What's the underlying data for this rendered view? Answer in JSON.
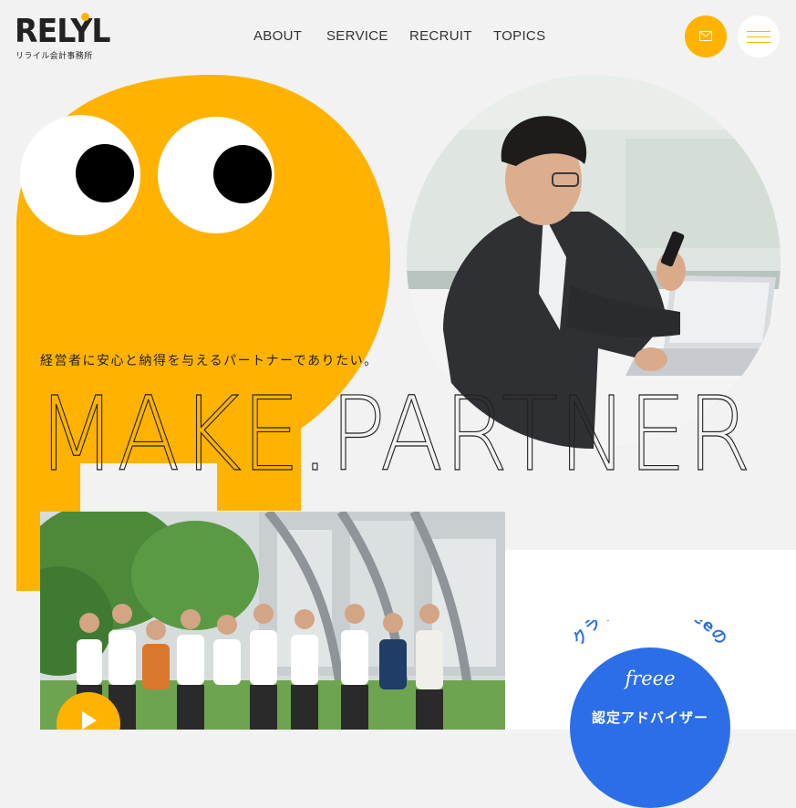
{
  "header": {
    "logo": {
      "word": "RELYL",
      "subtitle": "リライル会計事務所"
    },
    "nav": [
      {
        "label": "ABOUT"
      },
      {
        "label": "SERVICE"
      },
      {
        "label": "RECRUIT"
      },
      {
        "label": "TOPICS"
      }
    ],
    "mail_icon": "envelope-icon",
    "menu_icon": "hamburger-icon"
  },
  "hero": {
    "tagline": "経営者に安心と納得を与えるパートナーでありたい。",
    "headline": "MAKE.PARTNER"
  },
  "team": {
    "play_icon": "play-icon"
  },
  "badge": {
    "arc_text": "クラウド会計freeeの",
    "logo_text": "freee",
    "label": "認定アドバイザー"
  },
  "colors": {
    "accent": "#ffb300",
    "background": "#f1f2f1",
    "badge_blue": "#2c6ee8",
    "text": "#222222"
  }
}
